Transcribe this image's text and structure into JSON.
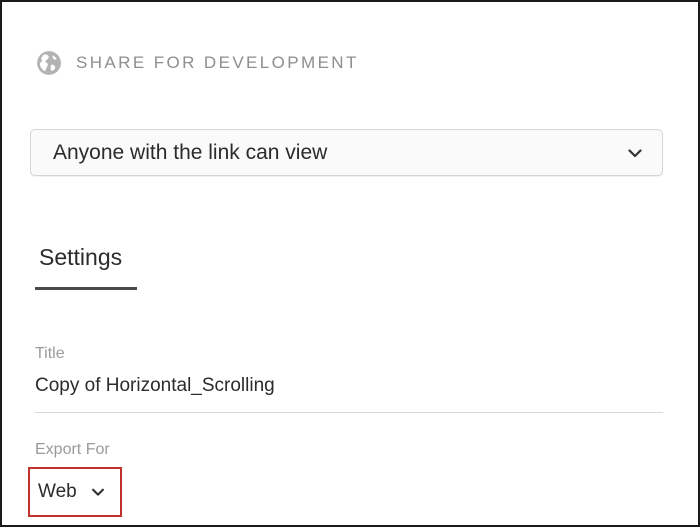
{
  "share": {
    "icon": "globe-icon",
    "title": "SHARE FOR DEVELOPMENT"
  },
  "access": {
    "selected": "Anyone with the link can view",
    "icon": "chevron-down-icon"
  },
  "tabs": {
    "settings": "Settings"
  },
  "settings": {
    "title_label": "Title",
    "title_value": "Copy of Horizontal_Scrolling",
    "export_label": "Export For",
    "export_value": "Web"
  },
  "colors": {
    "highlight": "#c0302d",
    "muted_text": "#9a9a9a",
    "tab_underline": "#4a4a4a"
  }
}
